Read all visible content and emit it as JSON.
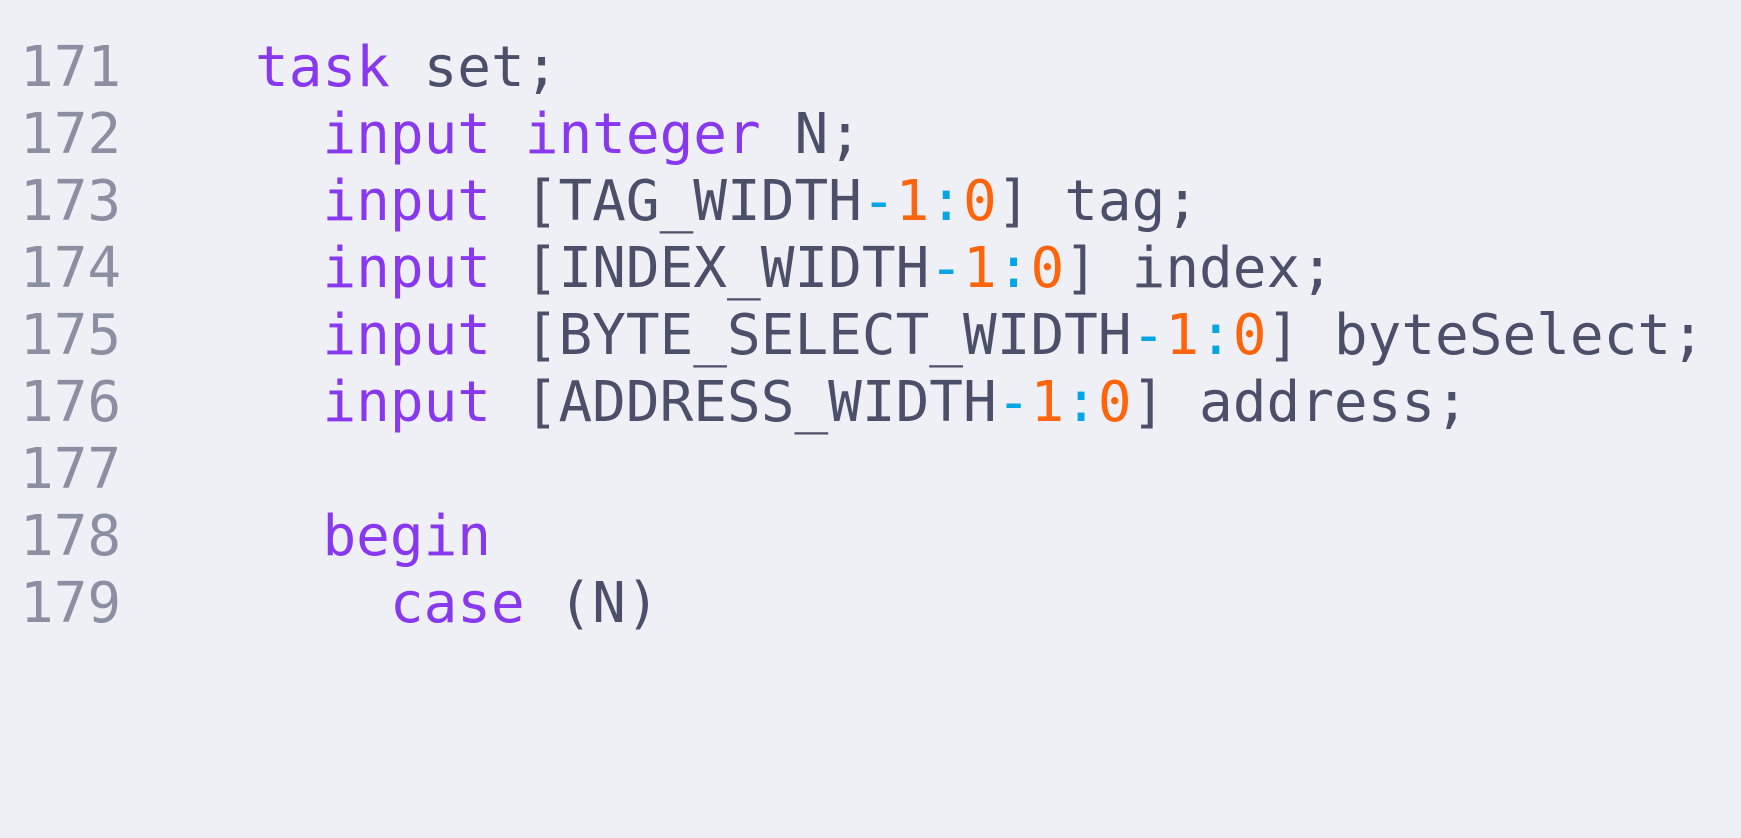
{
  "editor": {
    "lines": [
      {
        "number": "171",
        "tokens": [
          {
            "text": "task",
            "type": "kw"
          },
          {
            "text": " set;",
            "type": "text"
          }
        ]
      },
      {
        "number": "172",
        "tokens": [
          {
            "text": "  ",
            "type": "text"
          },
          {
            "text": "input",
            "type": "kw"
          },
          {
            "text": " ",
            "type": "text"
          },
          {
            "text": "integer",
            "type": "kw"
          },
          {
            "text": " N;",
            "type": "text"
          }
        ]
      },
      {
        "number": "173",
        "tokens": [
          {
            "text": "  ",
            "type": "text"
          },
          {
            "text": "input",
            "type": "kw"
          },
          {
            "text": " [TAG_WIDTH",
            "type": "text"
          },
          {
            "text": "-",
            "type": "op"
          },
          {
            "text": "1",
            "type": "num"
          },
          {
            "text": ":",
            "type": "op"
          },
          {
            "text": "0",
            "type": "num"
          },
          {
            "text": "] tag;",
            "type": "text"
          }
        ]
      },
      {
        "number": "174",
        "tokens": [
          {
            "text": "  ",
            "type": "text"
          },
          {
            "text": "input",
            "type": "kw"
          },
          {
            "text": " [INDEX_WIDTH",
            "type": "text"
          },
          {
            "text": "-",
            "type": "op"
          },
          {
            "text": "1",
            "type": "num"
          },
          {
            "text": ":",
            "type": "op"
          },
          {
            "text": "0",
            "type": "num"
          },
          {
            "text": "] index;",
            "type": "text"
          }
        ]
      },
      {
        "number": "175",
        "tokens": [
          {
            "text": "  ",
            "type": "text"
          },
          {
            "text": "input",
            "type": "kw"
          },
          {
            "text": " [BYTE_SELECT_WIDTH",
            "type": "text"
          },
          {
            "text": "-",
            "type": "op"
          },
          {
            "text": "1",
            "type": "num"
          },
          {
            "text": ":",
            "type": "op"
          },
          {
            "text": "0",
            "type": "num"
          },
          {
            "text": "] byteSelect;",
            "type": "text"
          }
        ]
      },
      {
        "number": "176",
        "tokens": [
          {
            "text": "  ",
            "type": "text"
          },
          {
            "text": "input",
            "type": "kw"
          },
          {
            "text": " [ADDRESS_WIDTH",
            "type": "text"
          },
          {
            "text": "-",
            "type": "op"
          },
          {
            "text": "1",
            "type": "num"
          },
          {
            "text": ":",
            "type": "op"
          },
          {
            "text": "0",
            "type": "num"
          },
          {
            "text": "] address;",
            "type": "text"
          }
        ]
      },
      {
        "number": "177",
        "tokens": []
      },
      {
        "number": "178",
        "tokens": [
          {
            "text": "  ",
            "type": "text"
          },
          {
            "text": "begin",
            "type": "kw"
          }
        ]
      },
      {
        "number": "179",
        "tokens": [
          {
            "text": "    ",
            "type": "text"
          },
          {
            "text": "case",
            "type": "kw"
          },
          {
            "text": " (N)",
            "type": "text"
          }
        ]
      }
    ]
  }
}
